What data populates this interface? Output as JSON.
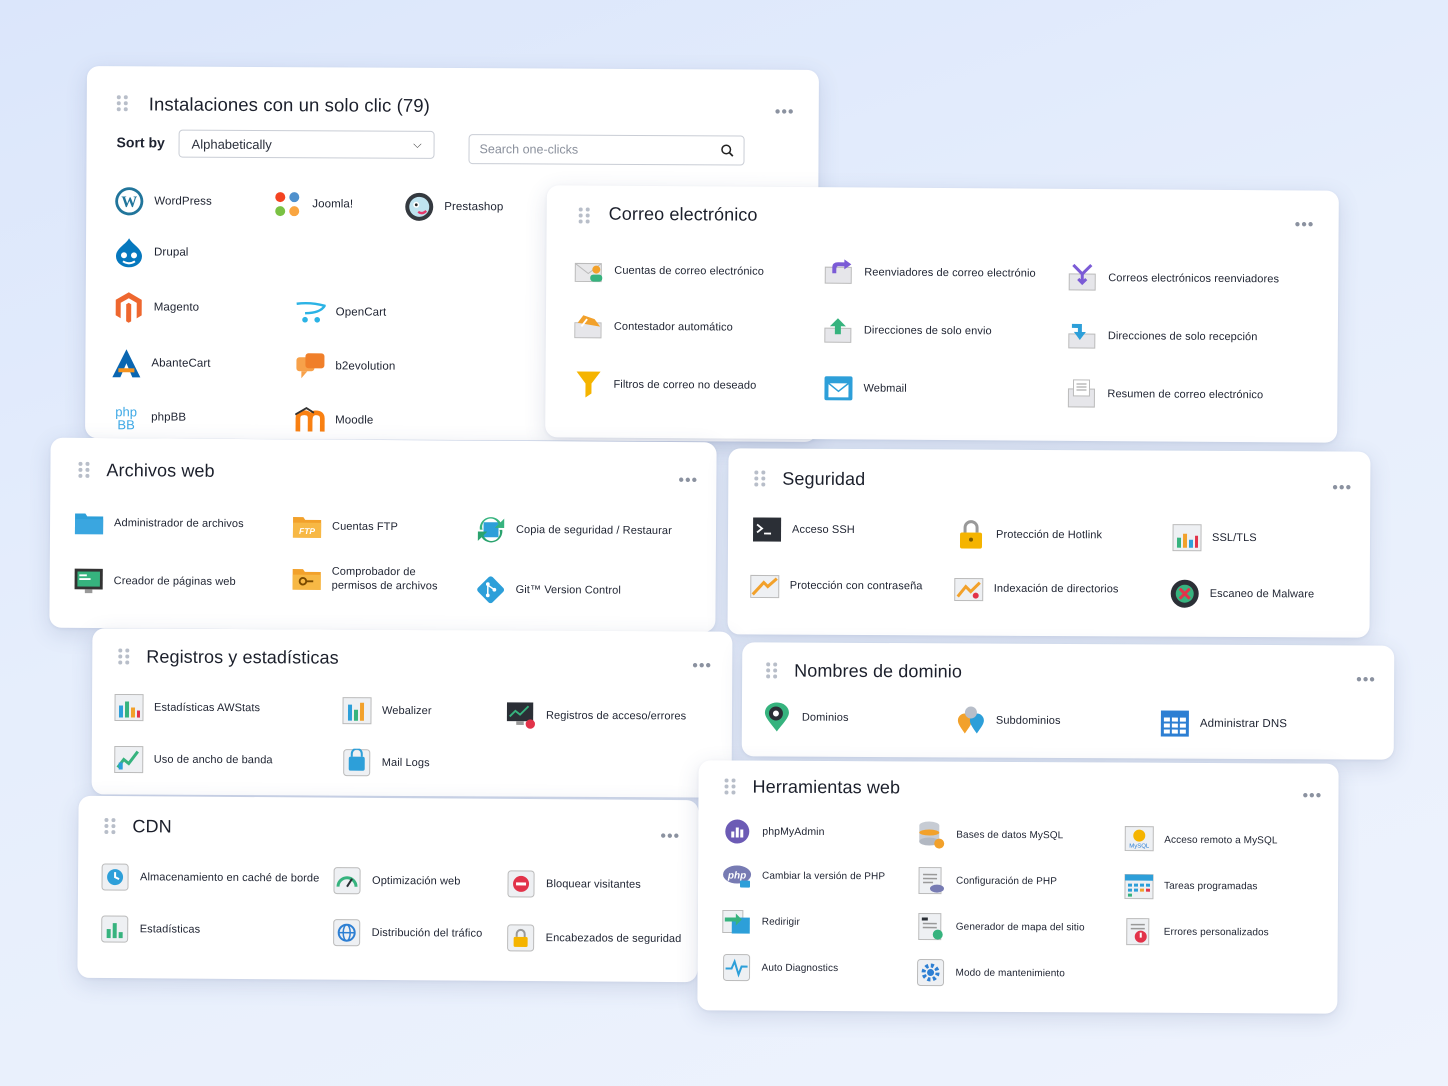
{
  "one_clicks": {
    "title": "Instalaciones con un solo clic (79)",
    "sort_label": "Sort by",
    "sort_value": "Alphabetically",
    "search_placeholder": "Search one-clicks",
    "apps": [
      "WordPress",
      "Joomla!",
      "Prestashop",
      "Drupal",
      "Magento",
      "OpenCart",
      "AbanteCart",
      "b2evolution",
      "phpBB",
      "Moodle"
    ]
  },
  "email": {
    "title": "Correo electrónico",
    "items": [
      "Cuentas de correo electrónico",
      "Reenviadores de correo electrónio",
      "Correos electrónicos reenviadores",
      "Contestador automático",
      "Direcciones de solo envio",
      "Direcciones de solo recepción",
      "Filtros de correo no deseado",
      "Webmail",
      "Resumen de correo electrónico"
    ]
  },
  "files": {
    "title": "Archivos web",
    "items": [
      "Administrador de archivos",
      "Cuentas FTP",
      "Copia de seguridad / Restaurar",
      "Creador de páginas web",
      "Comprobador de permisos de archivos",
      "Git™ Version Control"
    ]
  },
  "security": {
    "title": "Seguridad",
    "items": [
      "Acceso SSH",
      "Protección de Hotlink",
      "SSL/TLS",
      "Protección con contraseña",
      "Indexación de directorios",
      "Escaneo de Malware"
    ]
  },
  "stats": {
    "title": "Registros y estadísticas",
    "items": [
      "Estadísticas AWStats",
      "Webalizer",
      "Registros de acceso/errores",
      "Uso de ancho de banda",
      "Mail Logs"
    ]
  },
  "domains": {
    "title": "Nombres de dominio",
    "items": [
      "Dominios",
      "Subdominios",
      "Administrar DNS"
    ]
  },
  "cdn": {
    "title": "CDN",
    "items": [
      "Almacenamiento en caché de borde",
      "Optimización web",
      "Bloquear visitantes",
      "Estadísticas",
      "Distribución del tráfico",
      "Encabezados de seguridad"
    ]
  },
  "tools": {
    "title": "Herramientas web",
    "items": [
      "phpMyAdmin",
      "Bases de datos MySQL",
      "Acceso remoto a MySQL",
      "Cambiar la versión de PHP",
      "Configuración de PHP",
      "Tareas programadas",
      "Redirigir",
      "Generador de mapa del sitio",
      "Errores personalizados",
      "Auto Diagnostics",
      "Modo de mantenimiento"
    ]
  },
  "more_glyph": "•••",
  "colors": {
    "accent": "#2d7fd3",
    "orange": "#f2a12b",
    "green": "#36b37e",
    "purple": "#7b5bd6",
    "red": "#e2334a"
  }
}
